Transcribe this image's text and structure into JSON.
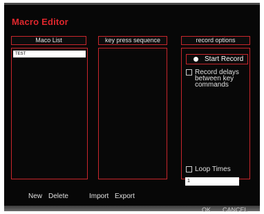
{
  "window": {
    "title": "Macro Editor"
  },
  "columns": {
    "macro_list_header": "Maco List",
    "key_sequence_header": "key press sequence",
    "record_options_header": "record options"
  },
  "macro_list": {
    "items": [
      "TEST"
    ]
  },
  "record_options": {
    "start_record_label": "Start Record",
    "record_delays_label_line1": "Record delays",
    "record_delays_label_line2": "between  key",
    "record_delays_label_line3": "commands",
    "record_delays_checked": false,
    "loop_times_label": "Loop Times",
    "loop_times_checked": false,
    "loop_times_value": "1"
  },
  "bottom_actions": {
    "new_label": "New",
    "delete_label": "Delete",
    "import_label": "Import",
    "export_label": "Export"
  },
  "footer": {
    "ok_label": "OK",
    "cancel_label": "CANCEL"
  },
  "colors": {
    "accent": "#c8262c",
    "title": "#e0272d",
    "background": "#070707"
  }
}
